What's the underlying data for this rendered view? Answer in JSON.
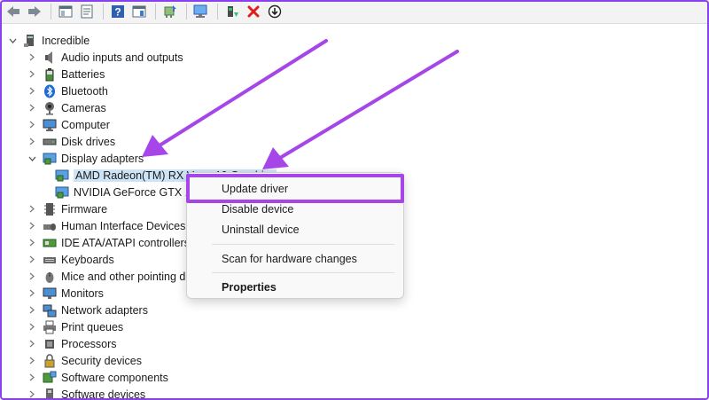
{
  "toolbar": {
    "buttons": [
      {
        "name": "back-icon"
      },
      {
        "name": "forward-icon"
      },
      {
        "name": "show-hide-console-tree-icon"
      },
      {
        "name": "properties-icon"
      },
      {
        "name": "help-icon"
      },
      {
        "name": "action-pane-icon"
      },
      {
        "name": "update-driver-icon"
      },
      {
        "name": "scan-hardware-icon"
      },
      {
        "name": "enable-device-icon"
      },
      {
        "name": "uninstall-icon"
      },
      {
        "name": "download-icon"
      }
    ]
  },
  "tree": {
    "root": "Incredible",
    "categories": [
      {
        "label": "Audio inputs and outputs",
        "icon": "speaker-icon"
      },
      {
        "label": "Batteries",
        "icon": "battery-icon"
      },
      {
        "label": "Bluetooth",
        "icon": "bluetooth-icon"
      },
      {
        "label": "Cameras",
        "icon": "camera-icon"
      },
      {
        "label": "Computer",
        "icon": "computer-icon"
      },
      {
        "label": "Disk drives",
        "icon": "disk-drive-icon"
      },
      {
        "label": "Display adapters",
        "icon": "display-adapter-icon",
        "expanded": true,
        "children": [
          {
            "label": "AMD Radeon(TM) RX Vega 10 Graphics",
            "icon": "display-adapter-icon",
            "selected": true
          },
          {
            "label": "NVIDIA GeForce GTX 1650",
            "icon": "display-adapter-icon"
          }
        ]
      },
      {
        "label": "Firmware",
        "icon": "firmware-icon"
      },
      {
        "label": "Human Interface Devices",
        "icon": "hid-icon"
      },
      {
        "label": "IDE ATA/ATAPI controllers",
        "icon": "ide-controller-icon"
      },
      {
        "label": "Keyboards",
        "icon": "keyboard-icon"
      },
      {
        "label": "Mice and other pointing devices",
        "icon": "mouse-icon"
      },
      {
        "label": "Monitors",
        "icon": "monitor-icon"
      },
      {
        "label": "Network adapters",
        "icon": "network-adapter-icon"
      },
      {
        "label": "Print queues",
        "icon": "printer-icon"
      },
      {
        "label": "Processors",
        "icon": "processor-icon"
      },
      {
        "label": "Security devices",
        "icon": "security-device-icon"
      },
      {
        "label": "Software components",
        "icon": "software-component-icon"
      },
      {
        "label": "Software devices",
        "icon": "software-device-icon"
      }
    ]
  },
  "context_menu": {
    "items": [
      {
        "label": "Update driver",
        "highlighted": true
      },
      {
        "label": "Disable device"
      },
      {
        "label": "Uninstall device"
      },
      {
        "label": "Scan for hardware changes"
      },
      {
        "label": "Properties",
        "bold": true
      }
    ]
  },
  "annotation": {
    "arrow_color": "#a646e8",
    "highlight_color": "#a646e8"
  }
}
